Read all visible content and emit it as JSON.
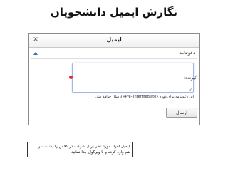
{
  "slide_title": "نگارش ایمیل دانشجویان",
  "window": {
    "title": "ایمیل",
    "close_glyph": "✕"
  },
  "panel": {
    "header_label": "دعوتنامه"
  },
  "form": {
    "recipient_label": "گیرنده:",
    "textarea_value": "",
    "hint_text": "این دعوتنامه برای دوره «Pre- Intermediate» ارسال خواهد شد.",
    "send_label": "ارسال"
  },
  "caption": {
    "line1": "ایمیل افراد مورد نظر برای شرکت در کلاس را پشت سر",
    "line2": "هم وارد کرده و با ویرگول جدا نمائید"
  },
  "colors": {
    "required": "#e02a2a",
    "focus_border": "#9fb8e6"
  }
}
